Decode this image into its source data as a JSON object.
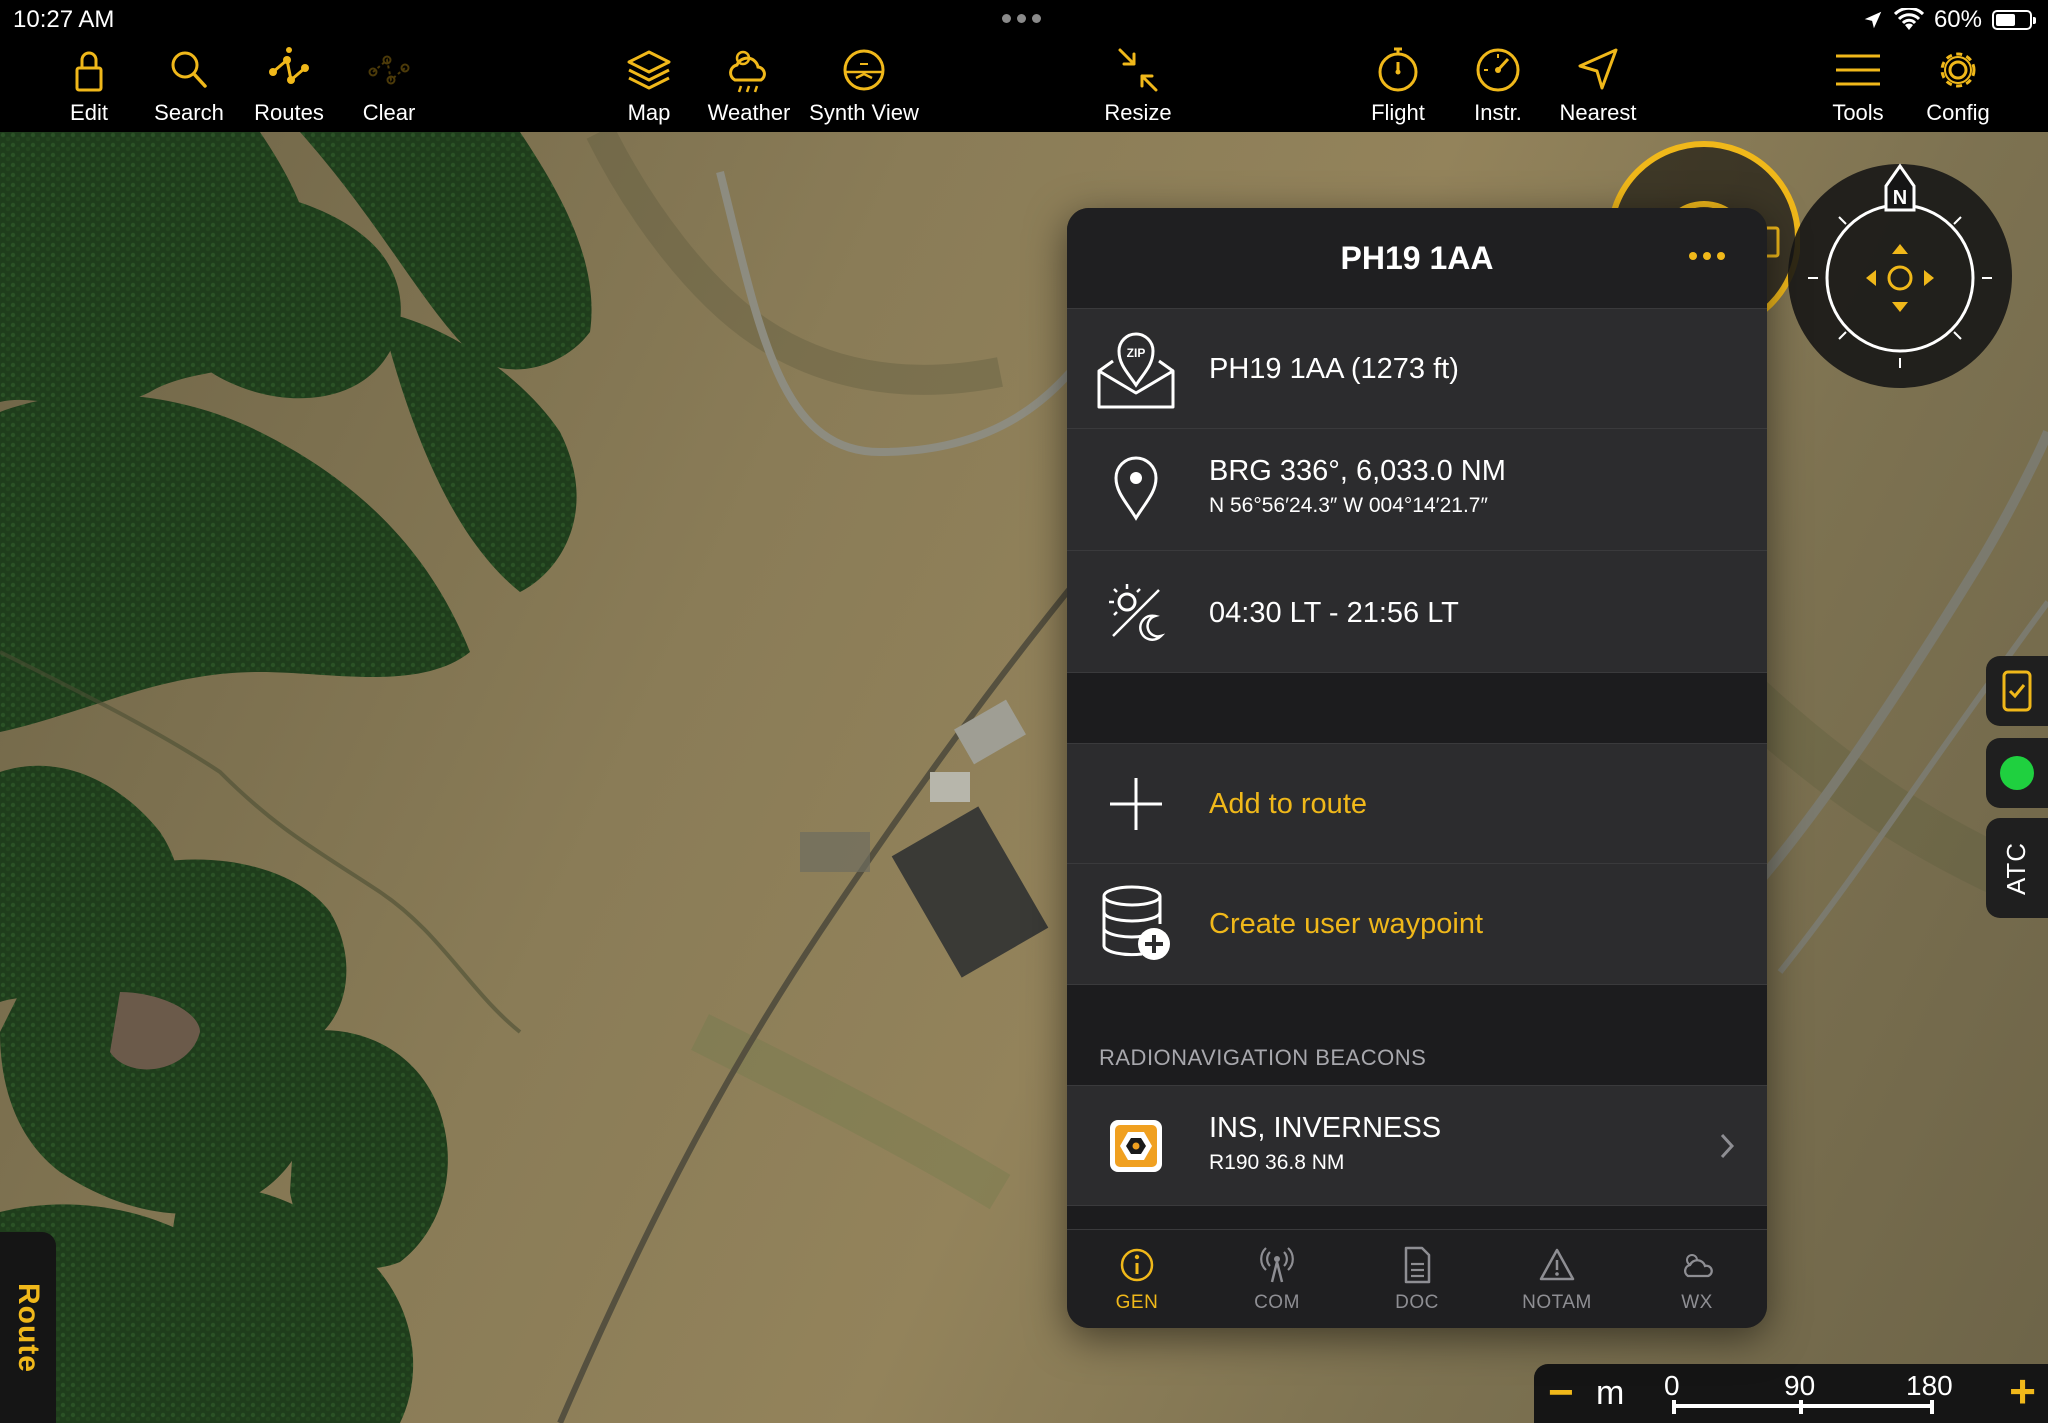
{
  "status_bar": {
    "time": "10:27 AM",
    "battery": "60%",
    "battery_level": 0.6
  },
  "toolbar": {
    "edit": "Edit",
    "search": "Search",
    "routes": "Routes",
    "clear": "Clear",
    "map": "Map",
    "weather": "Weather",
    "synth_view": "Synth View",
    "resize": "Resize",
    "flight": "Flight",
    "instr": "Instr.",
    "nearest": "Nearest",
    "tools": "Tools",
    "config": "Config"
  },
  "compass": {
    "north_label": "N"
  },
  "side_buttons": {
    "atc": "ATC"
  },
  "route_tab": {
    "label": "Route"
  },
  "scale_bar": {
    "unit": "m",
    "ticks": [
      "0",
      "90",
      "180"
    ]
  },
  "colors": {
    "accent": "#f0b81a",
    "panel_bg": "#1c1c1e",
    "row_bg": "#2c2c2e",
    "status_green": "#1fd03f"
  },
  "panel": {
    "title": "PH19 1AA",
    "rows": [
      {
        "icon": "zip-envelope-icon",
        "main": "PH19 1AA (1273 ft)"
      },
      {
        "icon": "location-pin-icon",
        "main": "BRG 336°, 6,033.0 NM",
        "sub": "N 56°56′24.3″ W 004°14′21.7″"
      },
      {
        "icon": "sun-moon-icon",
        "main": "04:30 LT - 21:56 LT"
      }
    ],
    "actions": [
      {
        "icon": "plus-icon",
        "label": "Add to route"
      },
      {
        "icon": "database-plus-icon",
        "label": "Create user waypoint"
      }
    ],
    "beacons_section": {
      "title": "RADIONAVIGATION BEACONS",
      "items": [
        {
          "icon": "vor-beacon-icon",
          "name": "INS, INVERNESS",
          "detail": "R190 36.8 NM"
        }
      ]
    },
    "tabs": [
      {
        "label": "GEN",
        "icon": "info-icon",
        "active": true
      },
      {
        "label": "COM",
        "icon": "antenna-icon",
        "active": false
      },
      {
        "label": "DOC",
        "icon": "document-icon",
        "active": false
      },
      {
        "label": "NOTAM",
        "icon": "warning-icon",
        "active": false
      },
      {
        "label": "WX",
        "icon": "cloud-sun-icon",
        "active": false
      }
    ]
  }
}
